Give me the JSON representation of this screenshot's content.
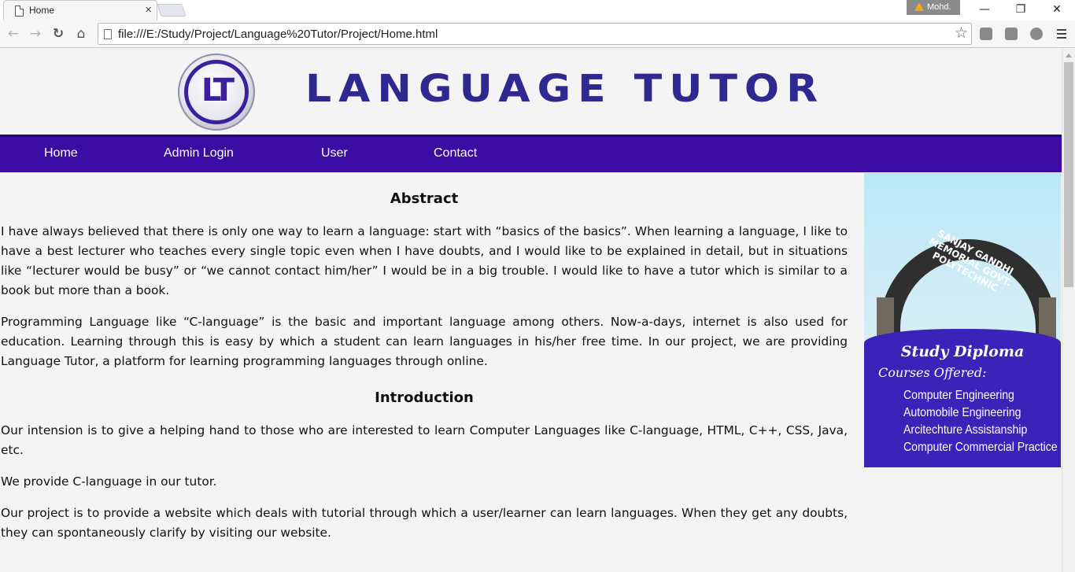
{
  "browser": {
    "tab_title": "Home",
    "tab_close": "×",
    "profile_name": "Mohd.",
    "url": "file:///E:/Study/Project/Language%20Tutor/Project/Home.html",
    "buttons": {
      "back": "←",
      "forward": "→",
      "reload": "↻",
      "home": "⌂",
      "star": "☆",
      "minimize": "—",
      "restore": "❐",
      "close": "✕"
    }
  },
  "site": {
    "logo_text": "LT",
    "title": "LANGUAGE TUTOR",
    "nav": [
      {
        "label": "Home"
      },
      {
        "label": "Admin Login"
      },
      {
        "label": "User"
      },
      {
        "label": "Contact"
      }
    ]
  },
  "content": {
    "abstract_heading": "Abstract",
    "abstract_p1": "I have always believed that there is only one way to learn a language: start with “basics of the basics”. When learning a language, I like to have a best lecturer who teaches every single topic even when I have doubts, and I would like to be explained in detail, but in situations like “lecturer would be busy” or “we cannot contact him/her” I would be in a big trouble.  I would like to have a tutor which is similar to a book but more than a book.",
    "abstract_p2": "Programming Language like “C-language” is the basic and important language among others. Now-a-days, internet is also used for education. Learning through this is easy by which a student can learn languages in his/her free time. In our project, we are providing Language Tutor, a platform for learning programming languages through online.",
    "intro_heading": "Introduction",
    "intro_p1": "Our intension is to give a helping hand to those who are interested to learn Computer Languages like C-language, HTML, C++, CSS, Java, etc.",
    "intro_p2": "We provide C-language in our tutor.",
    "intro_p3": "Our project is to provide a website which deals with tutorial through which a user/learner can learn languages. When they get any doubts, they can spontaneously clarify by visiting our website."
  },
  "promo": {
    "arch_text": "SANJAY GANDHI MEMORIAL GOVT. POLYTECHNIC",
    "heading": "Study Diploma",
    "subheading": "Courses Offered:",
    "courses": [
      "Computer Engineering",
      "Automobile Engineering",
      "Arcitechture Assistanship",
      "Computer Commercial Practice"
    ]
  },
  "colors": {
    "navbar": "#3a0ca3",
    "title": "#2e2891",
    "promo_panel": "#3b22b8"
  }
}
